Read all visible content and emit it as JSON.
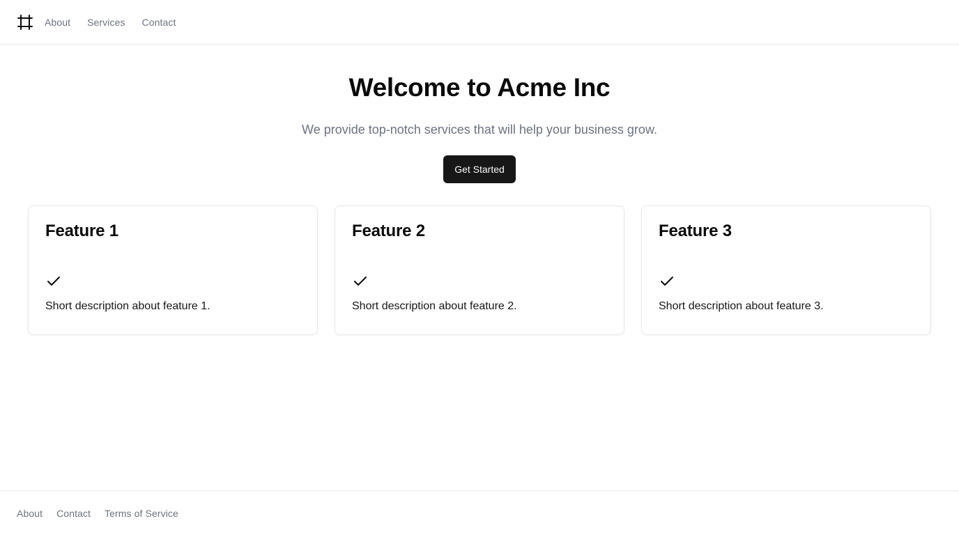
{
  "header": {
    "logo_icon": "frame-icon",
    "nav": [
      {
        "label": "About"
      },
      {
        "label": "Services"
      },
      {
        "label": "Contact"
      }
    ]
  },
  "hero": {
    "title": "Welcome to Acme Inc",
    "subtitle": "We provide top-notch services that will help your business grow.",
    "cta_label": "Get Started"
  },
  "features": [
    {
      "title": "Feature 1",
      "icon": "check-icon",
      "description": "Short description about feature 1."
    },
    {
      "title": "Feature 2",
      "icon": "check-icon",
      "description": "Short description about feature 2."
    },
    {
      "title": "Feature 3",
      "icon": "check-icon",
      "description": "Short description about feature 3."
    }
  ],
  "footer": {
    "links": [
      {
        "label": "About"
      },
      {
        "label": "Contact"
      },
      {
        "label": "Terms of Service"
      }
    ]
  },
  "colors": {
    "primary_button": "#171717",
    "muted_text": "#6b7280",
    "border": "#e5e7eb"
  }
}
